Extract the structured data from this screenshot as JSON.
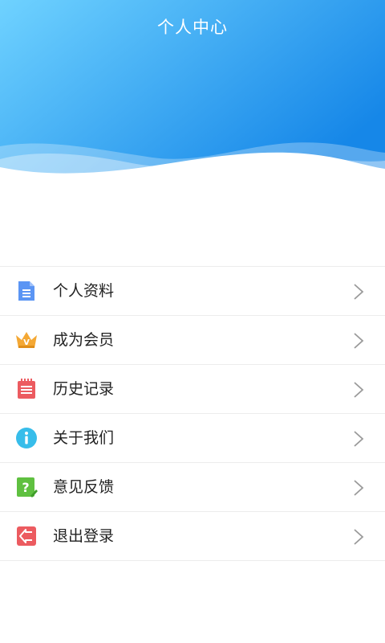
{
  "header": {
    "title": "个人中心"
  },
  "menu": {
    "items": [
      {
        "label": "个人资料",
        "icon": "document-icon",
        "color": "#5b95f4"
      },
      {
        "label": "成为会员",
        "icon": "crown-icon",
        "color": "#f4a834"
      },
      {
        "label": "历史记录",
        "icon": "notepad-icon",
        "color": "#ec5b60"
      },
      {
        "label": "关于我们",
        "icon": "info-icon",
        "color": "#37bdea"
      },
      {
        "label": "意见反馈",
        "icon": "feedback-icon",
        "color": "#5fc040"
      },
      {
        "label": "退出登录",
        "icon": "logout-icon",
        "color": "#ec5b60"
      }
    ],
    "chevron_icon": "chevron-right-icon"
  },
  "colors": {
    "header_gradient_start": "#6fd2ff",
    "header_gradient_end": "#1687e8",
    "divider": "#ececec",
    "chevron": "#9a9a9a"
  }
}
